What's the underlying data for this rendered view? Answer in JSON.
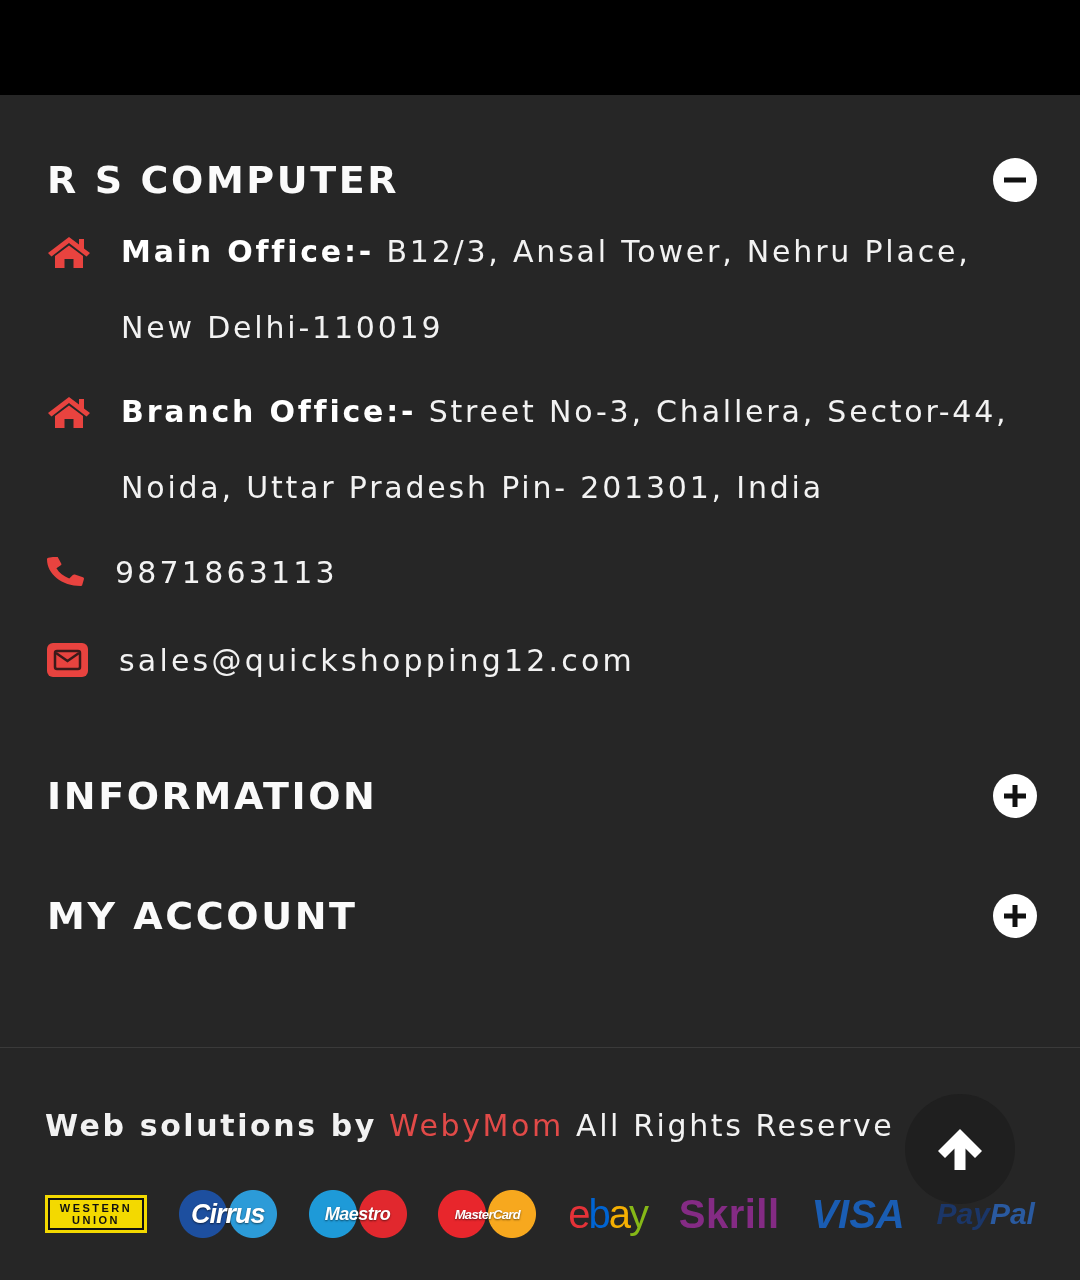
{
  "sections": [
    {
      "title": "R S COMPUTER",
      "expanded": true,
      "contacts": [
        {
          "kind": "address",
          "label": "Main Office:-",
          "text": "B12/3, Ansal Tower, Nehru Place, New Delhi-110019"
        },
        {
          "kind": "address",
          "label": "Branch Office:-",
          "text": "Street No-3, Challera, Sector-44, Noida, Uttar Pradesh Pin- 201301, India"
        },
        {
          "kind": "phone",
          "text": "9871863113"
        },
        {
          "kind": "email",
          "text": "sales@quickshopping12.com"
        }
      ]
    },
    {
      "title": "INFORMATION",
      "expanded": false
    },
    {
      "title": "MY ACCOUNT",
      "expanded": false
    }
  ],
  "footer": {
    "credit": "Web solutions by",
    "link": "WebyMom",
    "rights": "All Rights Reserve",
    "payment_methods": [
      {
        "kind": "western_union",
        "label": "WESTERN UNION"
      },
      {
        "kind": "cirrus",
        "label": "Cirrus"
      },
      {
        "kind": "maestro",
        "label": "Maestro"
      },
      {
        "kind": "mastercard",
        "label": "MasterCard"
      },
      {
        "kind": "ebay",
        "label": "ebay"
      },
      {
        "kind": "skrill",
        "label": "Skrill"
      },
      {
        "kind": "visa",
        "label": "VISA"
      },
      {
        "kind": "paypal",
        "label": "PayPal"
      }
    ]
  }
}
